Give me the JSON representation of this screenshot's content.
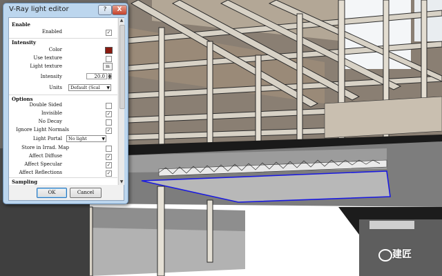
{
  "window": {
    "title": "V-Ray light editor",
    "help_glyph": "?",
    "close_glyph": "X"
  },
  "sections": {
    "enable": "Enable",
    "intensity": "Intensity",
    "options": "Options",
    "sampling": "Sampling"
  },
  "fields": {
    "enabled": {
      "label": "Enabled",
      "checked": "✓"
    },
    "color": {
      "label": "Color",
      "value": "#8a1a10"
    },
    "use_texture": {
      "label": "Use texture",
      "checked": ""
    },
    "light_texture": {
      "label": "Light texture",
      "button": "m"
    },
    "intensity": {
      "label": "Intensity",
      "value": "20.0"
    },
    "units": {
      "label": "Units",
      "value": "Default (Scal"
    },
    "double_sided": {
      "label": "Double Sided",
      "checked": ""
    },
    "invisible": {
      "label": "Invisible",
      "checked": "✓"
    },
    "no_decay": {
      "label": "No Decay",
      "checked": ""
    },
    "ignore_light_normals": {
      "label": "Ignore Light Normals",
      "checked": "✓"
    },
    "light_portal": {
      "label": "Light Portal",
      "value": "No light"
    },
    "store_in_irrad_map": {
      "label": "Store in Irrad. Map",
      "checked": ""
    },
    "affect_diffuse": {
      "label": "Affect Diffuse",
      "checked": "✓"
    },
    "affect_specular": {
      "label": "Affect Specular",
      "checked": "✓"
    },
    "affect_reflections": {
      "label": "Affect Reflections",
      "checked": "✓"
    }
  },
  "buttons": {
    "ok": "OK",
    "cancel": "Cancel"
  },
  "watermark": {
    "text": "建匠"
  },
  "colors": {
    "light_outline": "#1a1ae0",
    "dialog_frame": "#bcd6ee"
  }
}
